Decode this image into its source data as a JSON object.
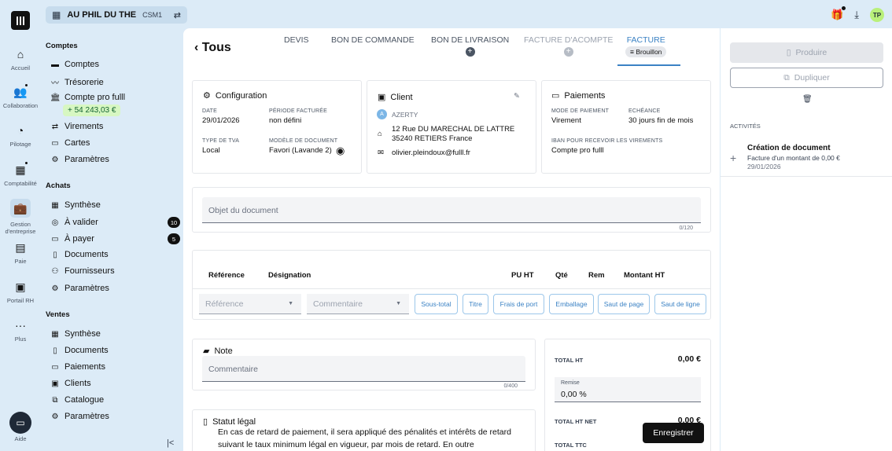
{
  "rail": [
    {
      "label": "Accueil",
      "icon": "home-icon"
    },
    {
      "label": "Collaboration",
      "icon": "people-icon"
    },
    {
      "label": "Pilotage",
      "icon": "gauge-icon"
    },
    {
      "label": "Comptabilité",
      "icon": "calculator-icon"
    },
    {
      "label_1": "Gestion",
      "label_2": "d'entreprise",
      "icon": "briefcase-icon"
    },
    {
      "label": "Paie",
      "icon": "payslip-icon"
    },
    {
      "label": "Portail RH",
      "icon": "calendar-icon"
    },
    {
      "label": "Plus",
      "icon": "more-icon"
    },
    {
      "label": "Aide",
      "icon": "chat-icon"
    }
  ],
  "company": {
    "name": "AU PHIL DU THE",
    "code": "CSM1"
  },
  "user": {
    "initials": "TP"
  },
  "sidebar": {
    "comptes_title": "Comptes",
    "comptes": [
      "Comptes",
      "Trésorerie",
      "Compte pro fulll",
      "Virements",
      "Cartes",
      "Paramètres"
    ],
    "balance": "+ 54 243,03 €",
    "achats_title": "Achats",
    "achats": [
      "Synthèse",
      "À valider",
      "À payer",
      "Documents",
      "Fournisseurs",
      "Paramètres"
    ],
    "a_valider_count": "10",
    "a_payer_count": "5",
    "ventes_title": "Ventes",
    "ventes": [
      "Synthèse",
      "Documents",
      "Paiements",
      "Clients",
      "Catalogue",
      "Paramètres"
    ]
  },
  "header": {
    "back": "Tous",
    "tabs": [
      "DEVIS",
      "BON DE COMMANDE",
      "BON DE LIVRAISON",
      "FACTURE D'ACOMPTE",
      "FACTURE"
    ],
    "status": "Brouillon"
  },
  "config": {
    "title": "Configuration",
    "date_label": "DATE",
    "date": "29/01/2026",
    "period_label": "PÉRIODE FACTURÉE",
    "period": "non défini",
    "tva_label": "TYPE DE TVA",
    "tva": "Local",
    "model_label": "MODÈLE DE DOCUMENT",
    "model": "Favori (Lavande 2)"
  },
  "client": {
    "title": "Client",
    "initial": "A",
    "name": "AZERTY",
    "address_1": "12 Rue DU MARECHAL DE LATTRE",
    "address_2": "35240 RETIERS France",
    "email": "olivier.pleindoux@fulll.fr"
  },
  "payments": {
    "title": "Paiements",
    "mode_label": "MODE DE PAIEMENT",
    "mode": "Virement",
    "due_label": "ECHÉANCE",
    "due": "30 jours fin de mois",
    "iban_label": "IBAN POUR RECEVOIR LES VIREMENTS",
    "iban": "Compte pro fulll"
  },
  "object": {
    "placeholder": "Objet du document",
    "counter": "0/120"
  },
  "lines": {
    "headers": [
      "Référence",
      "Désignation",
      "PU HT",
      "Qté",
      "Rem",
      "Montant HT"
    ],
    "ref_placeholder": "Référence",
    "comment_placeholder": "Commentaire",
    "chips": [
      "Sous-total",
      "Titre",
      "Frais de port",
      "Emballage",
      "Saut de page",
      "Saut de ligne"
    ]
  },
  "note": {
    "title": "Note",
    "placeholder": "Commentaire",
    "counter": "0/400"
  },
  "totals": {
    "total_ht_label": "TOTAL HT",
    "total_ht": "0,00 €",
    "remise_label": "Remise",
    "remise": "0,00 %",
    "total_net_label": "TOTAL HT NET",
    "total_net": "0,00 €",
    "total_ttc_label": "TOTAL TTC"
  },
  "legal": {
    "title": "Statut légal",
    "text": "En cas de retard de paiement, il sera appliqué des pénalités et intérêts de retard suivant le taux minimum légal en vigueur, par mois de retard. En outre"
  },
  "save": "Enregistrer",
  "actions": {
    "produire": "Produire",
    "dupliquer": "Dupliquer"
  },
  "activities": {
    "title": "ACTIVITÉS",
    "heading": "Création de document",
    "desc": "Facture d'un montant de 0,00 €",
    "date": "29/01/2026"
  }
}
